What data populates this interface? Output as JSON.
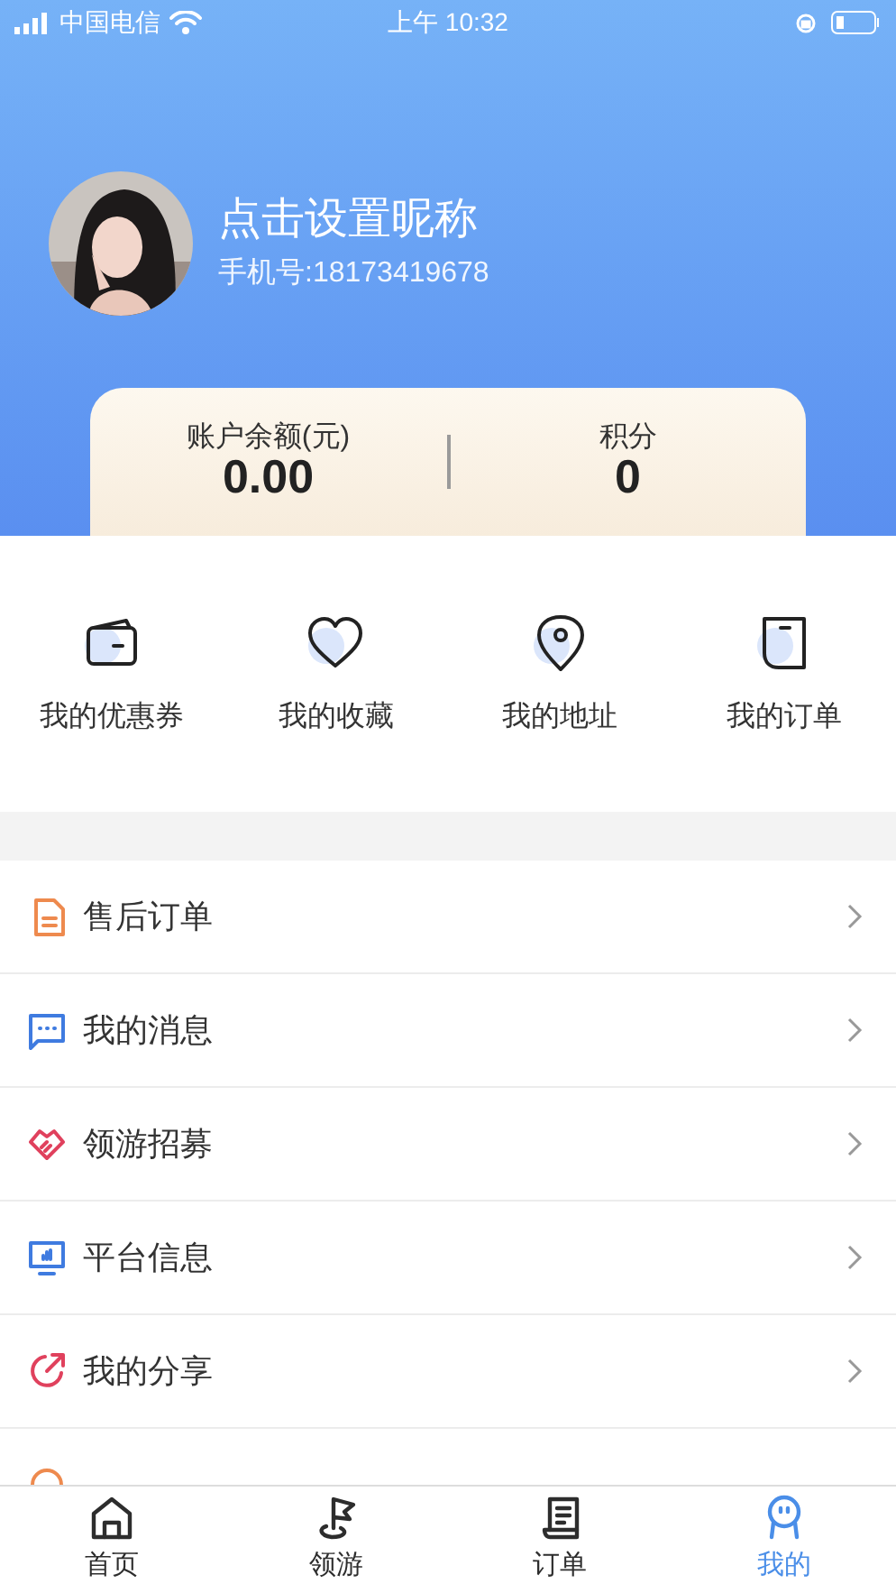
{
  "status_bar": {
    "carrier": "中国电信",
    "time": "上午 10:32"
  },
  "profile": {
    "nickname": "点击设置昵称",
    "phone": "手机号:18173419678"
  },
  "account": [
    {
      "label": "账户余额(元)",
      "value": "0.00"
    },
    {
      "label": "积分",
      "value": "0"
    }
  ],
  "shortcuts": [
    {
      "label": "我的优惠券"
    },
    {
      "label": "我的收藏"
    },
    {
      "label": "我的地址"
    },
    {
      "label": "我的订单"
    }
  ],
  "menu": [
    {
      "label": "售后订单"
    },
    {
      "label": "我的消息"
    },
    {
      "label": "领游招募"
    },
    {
      "label": "平台信息"
    },
    {
      "label": "我的分享"
    }
  ],
  "tabs": [
    {
      "label": "首页",
      "selected": false
    },
    {
      "label": "领游",
      "selected": false
    },
    {
      "label": "订单",
      "selected": false
    },
    {
      "label": "我的",
      "selected": true
    }
  ]
}
